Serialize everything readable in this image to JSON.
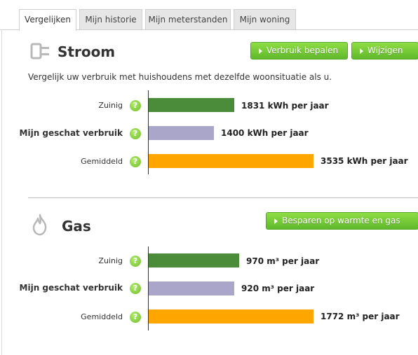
{
  "tabs": [
    {
      "label": "Vergelijken",
      "active": true
    },
    {
      "label": "Mijn historie",
      "active": false
    },
    {
      "label": "Mijn meterstanden",
      "active": false
    },
    {
      "label": "Mijn woning",
      "active": false
    }
  ],
  "stroom": {
    "title": "Stroom",
    "icon": "plug-icon",
    "buttons": {
      "verbruik": "Verbruik bepalen",
      "wijzigen": "Wijzigen"
    },
    "intro": "Vergelijk uw verbruik met huishoudens met dezelfde woonsituatie als u.",
    "rows": [
      {
        "label": "Zuinig",
        "value": 1831,
        "value_text": "1831 kWh per jaar",
        "color": "#4a8c3a"
      },
      {
        "label": "Mijn geschat verbruik",
        "value": 1400,
        "value_text": "1400 kWh per jaar",
        "color": "#a9a6c9"
      },
      {
        "label": "Gemiddeld",
        "value": 3535,
        "value_text": "3535 kWh per jaar",
        "color": "#ffa500"
      }
    ]
  },
  "gas": {
    "title": "Gas",
    "icon": "flame-icon",
    "buttons": {
      "besparen": "Besparen op warmte en gas"
    },
    "rows": [
      {
        "label": "Zuinig",
        "value": 970,
        "value_text": "970 m³ per jaar",
        "color": "#4a8c3a"
      },
      {
        "label": "Mijn geschat verbruik",
        "value": 920,
        "value_text": "920 m³ per jaar",
        "color": "#a9a6c9"
      },
      {
        "label": "Gemiddeld",
        "value": 1772,
        "value_text": "1772 m³ per jaar",
        "color": "#ffa500"
      }
    ]
  },
  "help_glyph": "?",
  "colors": {
    "accent_green": "#6fc13a",
    "tab_inactive": "#e6e6e6"
  }
}
